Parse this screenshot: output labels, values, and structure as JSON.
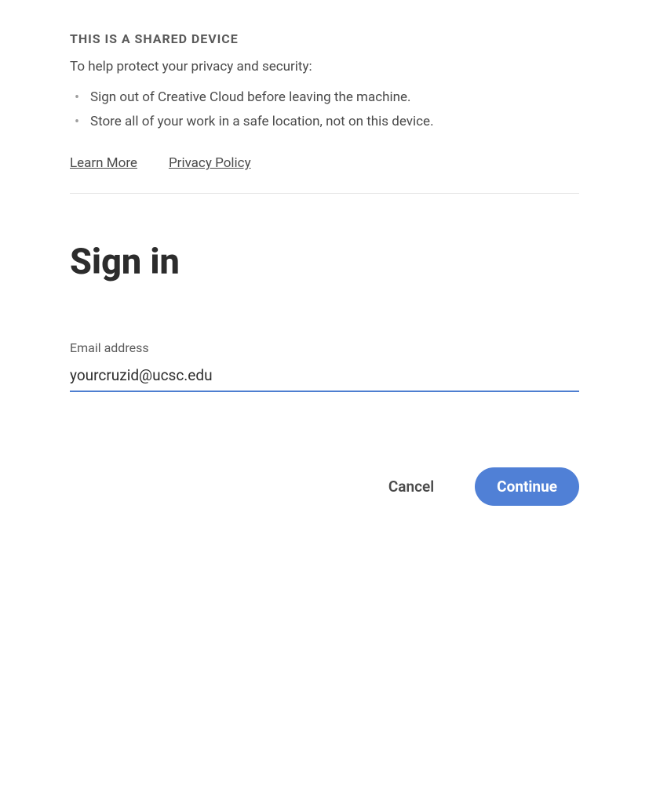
{
  "banner": {
    "heading": "THIS IS A SHARED DEVICE",
    "subtext": "To help protect your privacy and security:",
    "items": [
      "Sign out of Creative Cloud before leaving the machine.",
      "Store all of your work in a safe location, not on this device."
    ]
  },
  "links": {
    "learn_more": "Learn More ",
    "privacy_policy": "Privacy Policy"
  },
  "signin": {
    "title": "Sign in",
    "email_label": "Email address",
    "email_value": "yourcruzid@ucsc.edu"
  },
  "actions": {
    "cancel": "Cancel",
    "continue": "Continue"
  }
}
